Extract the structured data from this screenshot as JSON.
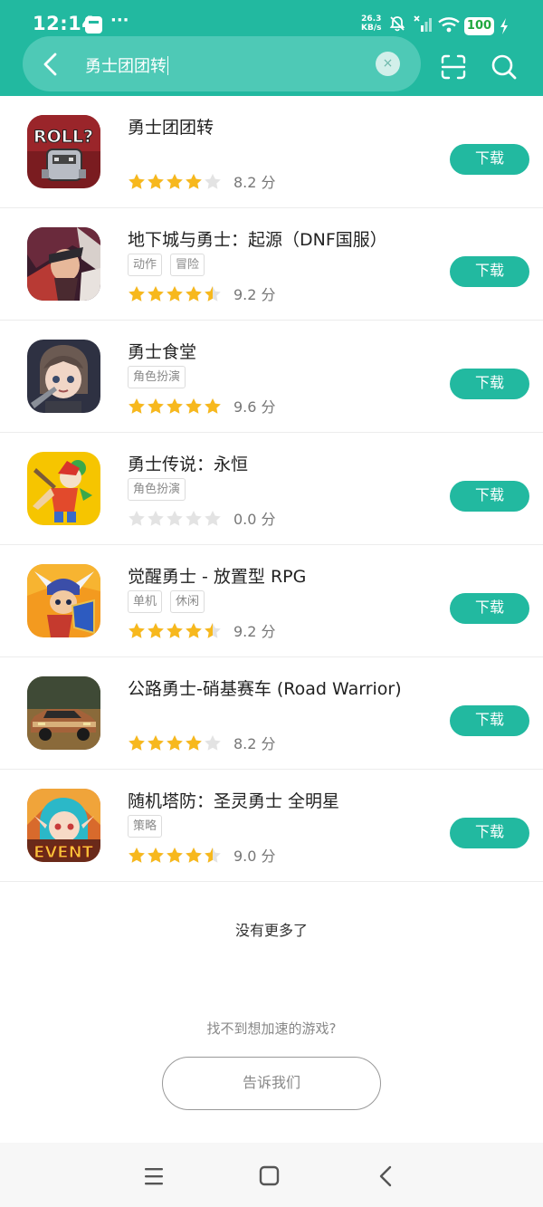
{
  "status": {
    "time": "12:14",
    "dots": "···",
    "net_speed_value": "26.3",
    "net_speed_unit": "KB/s",
    "battery": "100"
  },
  "search": {
    "query": "勇士团团转",
    "clear": "×"
  },
  "items": [
    {
      "name": "勇士团团转",
      "tags": [],
      "stars": 4,
      "score": "8.2 分",
      "button": "下载"
    },
    {
      "name": "地下城与勇士：起源（DNF国服）",
      "tags": [
        "动作",
        "冒险"
      ],
      "stars": 4.5,
      "score": "9.2 分",
      "button": "下载"
    },
    {
      "name": "勇士食堂",
      "tags": [
        "角色扮演"
      ],
      "stars": 5,
      "score": "9.6 分",
      "button": "下载"
    },
    {
      "name": "勇士传说：永恒",
      "tags": [
        "角色扮演"
      ],
      "stars": 0,
      "score": "0.0 分",
      "button": "下载"
    },
    {
      "name": "觉醒勇士 - 放置型 RPG",
      "tags": [
        "单机",
        "休闲"
      ],
      "stars": 4.5,
      "score": "9.2 分",
      "button": "下载"
    },
    {
      "name": "公路勇士-硝基赛车 (Road Warrior)",
      "tags": [],
      "stars": 4,
      "score": "8.2 分",
      "button": "下载"
    },
    {
      "name": "随机塔防：圣灵勇士 全明星",
      "tags": [
        "策略"
      ],
      "stars": 4.5,
      "score": "9.0 分",
      "button": "下载"
    }
  ],
  "icon_art": [
    "roll-game-knight",
    "dnf-warrior",
    "chef-girl",
    "jester-warrior",
    "winged-helmet-hero",
    "muscle-car",
    "event-elf-girl"
  ],
  "icon_text": {
    "roll": "ROLL?",
    "event": "EVENT"
  },
  "footer": {
    "no_more": "没有更多了",
    "not_found": "找不到想加速的游戏?",
    "tell_us": "告诉我们"
  },
  "colors": {
    "accent": "#22b9a0",
    "star": "#f7b81d",
    "star_empty": "#e3e3e3"
  }
}
